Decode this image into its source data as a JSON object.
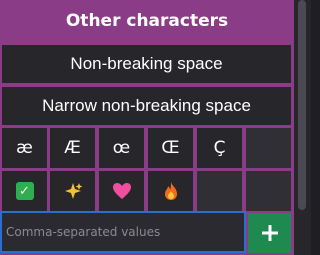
{
  "panel": {
    "title": "Other characters",
    "buttons": [
      {
        "label": "Non-breaking space"
      },
      {
        "label": "Narrow non-breaking space"
      }
    ],
    "chars": [
      "æ",
      "Æ",
      "œ",
      "Œ",
      "Ç"
    ],
    "emojis": [
      "check-mark",
      "sparkles",
      "pink-heart",
      "fire"
    ]
  },
  "input": {
    "placeholder": "Comma-separated values",
    "value": ""
  },
  "add_button": {
    "label": "+"
  },
  "colors": {
    "panel_border": "#8a3c87",
    "cell_bg": "#26262b",
    "empty_cell_bg": "#2f2f35",
    "input_border": "#2a6fcf",
    "add_button": "#1f8a50"
  }
}
